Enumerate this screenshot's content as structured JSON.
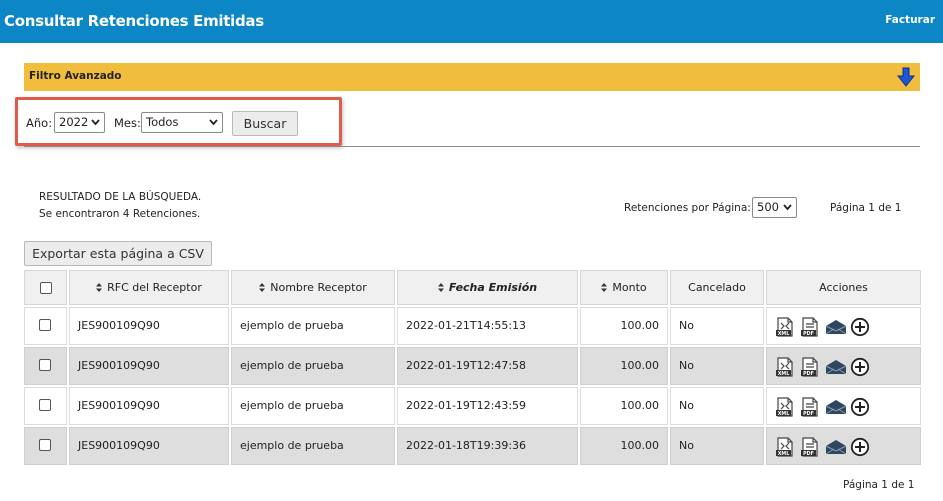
{
  "header": {
    "title": "Consultar Retenciones Emitidas",
    "link": "Facturar"
  },
  "filter": {
    "label": "Filtro Avanzado"
  },
  "form": {
    "year_label": "Año:",
    "year_value": "2022",
    "month_label": "Mes:",
    "month_value": "Todos",
    "search_label": "Buscar"
  },
  "results": {
    "title": "RESULTADO DE LA BÚSQUEDA.",
    "count": "Se encontraron 4 Retenciones.",
    "per_page_label": "Retenciones por Página:",
    "per_page_value": "500",
    "page_info": "Página 1 de 1",
    "export_label": "Exportar esta página a CSV"
  },
  "table": {
    "columns": [
      "RFC del Receptor",
      "Nombre Receptor",
      "Fecha Emisión",
      "Monto",
      "Cancelado",
      "Acciones"
    ],
    "rows": [
      {
        "rfc": "JES900109Q90",
        "name": "ejemplo de prueba",
        "date": "2022-01-21T14:55:13",
        "amount": "100.00",
        "cancelled": "No"
      },
      {
        "rfc": "JES900109Q90",
        "name": "ejemplo de prueba",
        "date": "2022-01-19T12:47:58",
        "amount": "100.00",
        "cancelled": "No"
      },
      {
        "rfc": "JES900109Q90",
        "name": "ejemplo de prueba",
        "date": "2022-01-19T12:43:59",
        "amount": "100.00",
        "cancelled": "No"
      },
      {
        "rfc": "JES900109Q90",
        "name": "ejemplo de prueba",
        "date": "2022-01-18T19:39:36",
        "amount": "100.00",
        "cancelled": "No"
      }
    ]
  },
  "icons": {
    "xml": "xml-file-icon",
    "pdf": "pdf-file-icon",
    "email": "envelope-icon",
    "more": "plus-circle-icon",
    "toggle": "arrow-down-icon"
  },
  "colors": {
    "header": "#0c86c4",
    "filter_bar": "#f1bd3d",
    "highlight": "#e15b4d",
    "row_alt": "#dedede"
  }
}
